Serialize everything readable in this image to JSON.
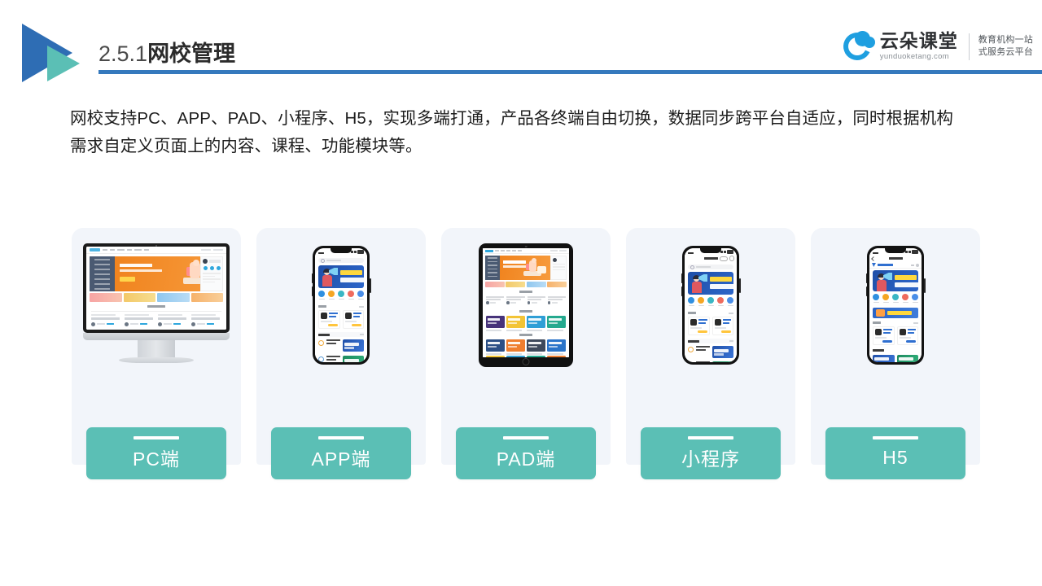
{
  "header": {
    "section_number": "2.5.1",
    "title_cn": "网校管理",
    "logo_icon": "double-triangle-play-icon"
  },
  "brand": {
    "name": "云朵课堂",
    "url": "yunduoketang.com",
    "tagline_line1": "教育机构一站",
    "tagline_line2": "式服务云平台",
    "cloud_icon": "cloud-icon",
    "accent_color": "#1F9FE0"
  },
  "body": {
    "line1": "网校支持PC、APP、PAD、小程序、H5，实现多端打通，产品各终端自由切换，数据同步跨平台自适应，同时根据机构",
    "line2": "需求自定义页面上的内容、课程、功能模块等。"
  },
  "colors": {
    "teal": "#5BBFB5",
    "blue_rule": "#3579BD",
    "logo_blue": "#2E6DB4",
    "card_bg": "#F2F5FA",
    "hero_orange": "#F0831E",
    "hero_blue": "#2D66C9"
  },
  "cards": [
    {
      "label": "PC端",
      "device": "imac",
      "device_icon": "desktop-monitor-icon"
    },
    {
      "label": "APP端",
      "device": "iphone",
      "device_icon": "smartphone-icon"
    },
    {
      "label": "PAD端",
      "device": "ipad",
      "device_icon": "tablet-icon"
    },
    {
      "label": "小程序",
      "device": "iphone",
      "device_icon": "smartphone-icon"
    },
    {
      "label": "H5",
      "device": "iphone",
      "device_icon": "smartphone-icon"
    }
  ]
}
